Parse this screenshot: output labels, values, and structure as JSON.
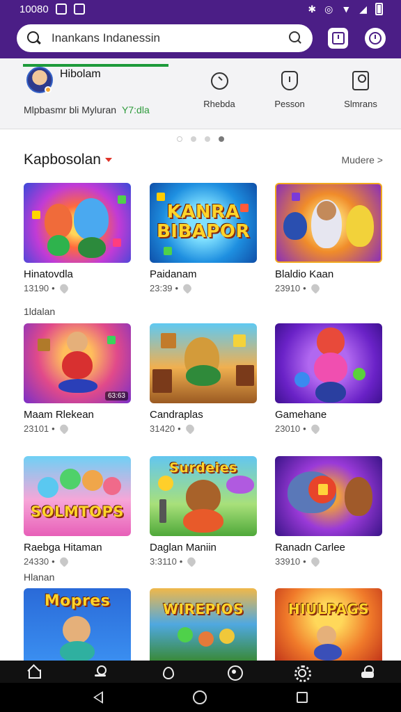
{
  "status_bar": {
    "time": "10080",
    "icons": [
      "notification-icon",
      "app-icon",
      "bluetooth-icon",
      "sync-icon",
      "wifi-icon",
      "signal-icon",
      "battery-icon"
    ]
  },
  "header": {
    "search_placeholder": "Inankans Indanessin",
    "right_icons": [
      "notification-square-icon",
      "profile-circle-icon"
    ],
    "accent": "#4b1e86"
  },
  "tabs": {
    "main_title": "Hibolam",
    "main_subtitle": "Mlpbasmr bli Myluran",
    "main_subtitle_accent": "Y7:dla",
    "items": [
      {
        "label": "Rhebda",
        "icon": "search-icon"
      },
      {
        "label": "Pesson",
        "icon": "shield-icon"
      },
      {
        "label": "Slmrans",
        "icon": "person-card-icon"
      }
    ],
    "underline_color": "#1d9a3a"
  },
  "carousel": {
    "count": 4,
    "active_index": 3
  },
  "section": {
    "title": "Kapbosolan",
    "more_label": "Mudere >"
  },
  "groups": [
    {
      "label": ""
    },
    {
      "label": "1ldalan"
    },
    {
      "label": ""
    },
    {
      "label": "Hlanan"
    }
  ],
  "cards": [
    {
      "title": "Hinatovdla",
      "meta": "13190",
      "thumb_text": ""
    },
    {
      "title": "Paidanam",
      "meta": "23:39",
      "thumb_text": "KANRA BIBAPOR"
    },
    {
      "title": "Blaldio Kaan",
      "meta": "23910",
      "thumb_text": ""
    },
    {
      "title": "Maam Rlekean",
      "meta": "23101",
      "thumb_text": ""
    },
    {
      "title": "Candraplas",
      "meta": "31420",
      "thumb_text": ""
    },
    {
      "title": "Gamehane",
      "meta": "23010",
      "thumb_text": ""
    },
    {
      "title": "Raebga Hitaman",
      "meta": "24330",
      "thumb_text": "SOLMTOPS"
    },
    {
      "title": "Daglan Maniin",
      "meta": "3:3110",
      "thumb_text": "Surdeies"
    },
    {
      "title": "Ranadn Carlee",
      "meta": "33910",
      "thumb_text": ""
    },
    {
      "title": "",
      "meta": "",
      "thumb_text": "Mopres"
    },
    {
      "title": "",
      "meta": "",
      "thumb_text": "WIREPIOS"
    },
    {
      "title": "",
      "meta": "",
      "thumb_text": "HIULPAGS"
    }
  ],
  "thumb_badges": [
    "63:63",
    "",
    "",
    "",
    "",
    "",
    "",
    "",
    ""
  ],
  "bottom_nav": [
    "home-icon",
    "user-icon",
    "drop-icon",
    "circle-icon",
    "gear-icon",
    "lock-icon"
  ]
}
